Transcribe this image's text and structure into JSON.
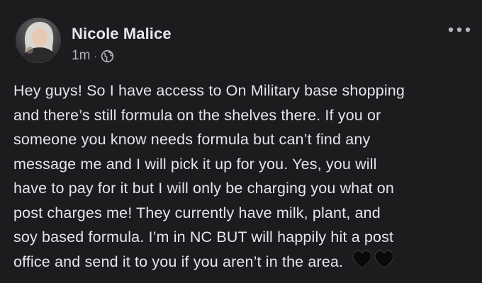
{
  "post": {
    "author": "Nicole Malice",
    "timestamp": "1m",
    "separator": "·",
    "privacy_icon": "globe-icon",
    "more_icon": "more-horizontal-icon",
    "body_lines": [
      "Hey guys! So I have access to On Military base shopping",
      "and there’s still formula on the shelves there. If you or",
      "someone you know needs formula but can’t find any",
      "message me and I will pick it up for you. Yes, you will",
      "have to pay for it but I will only be charging you what on",
      "post charges me! They currently have milk, plant, and",
      "soy based formula. I’m in NC BUT will happily hit a post",
      "office and send it to you if you aren’t in the area."
    ],
    "emoji": [
      "black-heart",
      "black-heart"
    ]
  },
  "colors": {
    "background": "#1c1c1e",
    "text_primary": "#e4e6eb",
    "text_secondary": "#b0b3b8"
  }
}
